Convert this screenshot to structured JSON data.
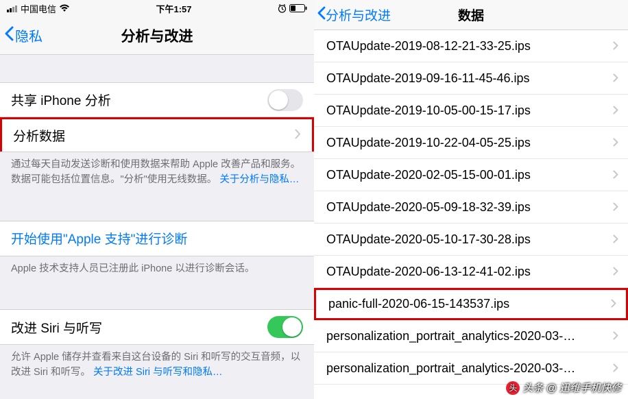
{
  "left": {
    "status": {
      "carrier": "中国电信",
      "time": "下午1:57"
    },
    "nav": {
      "back": "隐私",
      "title": "分析与改进"
    },
    "share": {
      "label": "共享 iPhone 分析",
      "on": false
    },
    "data": {
      "label": "分析数据"
    },
    "foot1": {
      "text": "通过每天自动发送诊断和使用数据来帮助 Apple 改善产品和服务。数据可能包括位置信息。\"分析\"使用无线数据。",
      "link": "关于分析与隐私…"
    },
    "diag": {
      "label": "开始使用\"Apple 支持\"进行诊断"
    },
    "foot2": {
      "text": "Apple 技术支持人员已注册此 iPhone 以进行诊断会话。"
    },
    "siri": {
      "label": "改进 Siri 与听写",
      "on": true
    },
    "foot3": {
      "text": "允许 Apple 储存并查看来自这台设备的 Siri 和听写的交互音频，以改进 Siri 和听写。",
      "link": "关于改进 Siri 与听写和隐私…"
    }
  },
  "right": {
    "nav": {
      "back": "分析与改进",
      "title": "数据"
    },
    "items": [
      "OTAUpdate-2019-08-12-21-33-25.ips",
      "OTAUpdate-2019-09-16-11-45-46.ips",
      "OTAUpdate-2019-10-05-00-15-17.ips",
      "OTAUpdate-2019-10-22-04-05-25.ips",
      "OTAUpdate-2020-02-05-15-00-01.ips",
      "OTAUpdate-2020-05-09-18-32-39.ips",
      "OTAUpdate-2020-05-10-17-30-28.ips",
      "OTAUpdate-2020-06-13-12-41-02.ips",
      "panic-full-2020-06-15-143537.ips",
      "personalization_portrait_analytics-2020-03-…",
      "personalization_portrait_analytics-2020-03-…"
    ],
    "highlight_index": 8
  },
  "watermark": "头条 @ 迅维手机快修"
}
